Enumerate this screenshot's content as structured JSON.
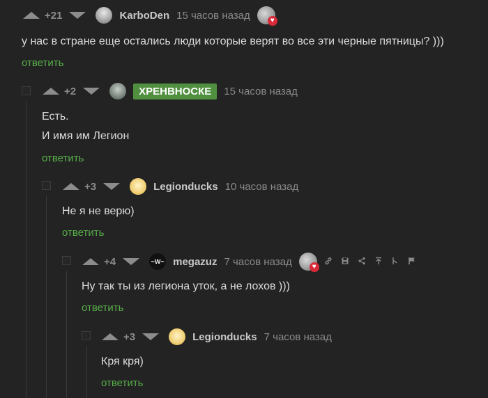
{
  "comments": [
    {
      "rating": "+21",
      "username": "KarboDen",
      "time": "15 часов назад",
      "text": "у нас в стране еще остались люди которые верят во все эти черные пятницы? )))",
      "reply_label": "ответить"
    },
    {
      "rating": "+2",
      "username_tag": "ХРЕНВНОСКЕ",
      "time": "15 часов назад",
      "text_lines": [
        "Есть.",
        "И имя им Легион"
      ],
      "reply_label": "ответить"
    },
    {
      "rating": "+3",
      "username": "Legionducks",
      "time": "10 часов назад",
      "text": "Не я не верю)",
      "reply_label": "ответить"
    },
    {
      "rating": "+4",
      "username": "megazuz",
      "time": "7 часов назад",
      "text": "Ну так ты из легиона уток, а не лохов )))",
      "reply_label": "ответить",
      "tools": [
        "link-icon",
        "save-icon",
        "share-icon",
        "go-to-parent-icon",
        "branch-icon",
        "report-flag-icon"
      ]
    },
    {
      "rating": "+3",
      "username": "Legionducks",
      "time": "7 часов назад",
      "text": "Кря кря)",
      "reply_label": "ответить"
    }
  ],
  "colors": {
    "background": "#232323",
    "reply_link": "#58b04a",
    "tag_bg": "#4f8f3f",
    "muted": "#8c8c8c"
  }
}
